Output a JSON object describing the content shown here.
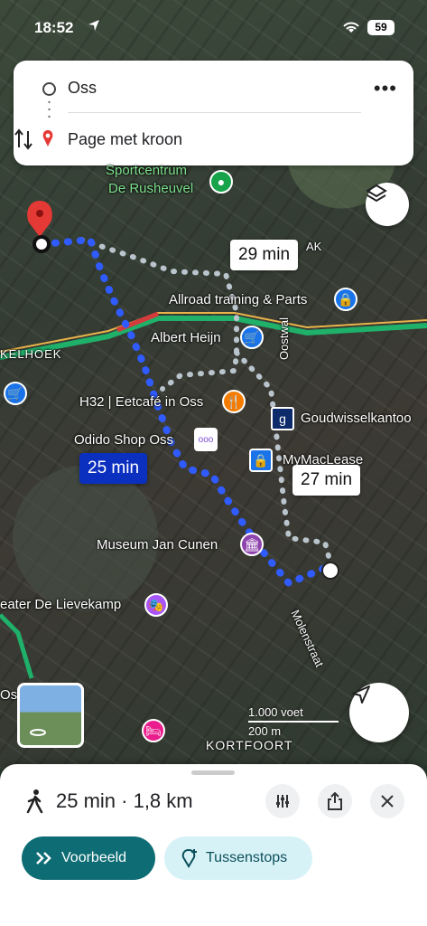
{
  "status_bar": {
    "time": "18:52",
    "battery": "59"
  },
  "route_card": {
    "origin": "Oss",
    "destination": "Page met kroon"
  },
  "map_labels": {
    "sportcentrum_1": "Sportcentrum",
    "sportcentrum_2": "De Rusheuvel",
    "allroad": "Allroad training & Parts",
    "albert_heijn": "Albert Heijn",
    "kelhoek": "KELHOEK",
    "h32": "H32 | Eetcafé in Oss",
    "goudwissel": "Goudwisselkantoo",
    "odido": "Odido Shop Oss",
    "mymaclease": "MyMacLease",
    "museum": "Museum Jan Cunen",
    "theater": "eater De Lievekamp",
    "oostwal": "Oostwal",
    "molenstraat": "Molenstraat",
    "kortfoort": "KORTFOORT",
    "oss_left": "Oss",
    "ak": "AK"
  },
  "callouts": {
    "alt1": "29 min",
    "selected": "25 min",
    "alt2": "27 min"
  },
  "scale": {
    "feet": "1.000 voet",
    "meters": "200 m"
  },
  "sheet": {
    "summary": "25 min · 1,8 km",
    "preview_label": "Voorbeeld",
    "stops_label": "Tussenstops"
  },
  "icons": {
    "walk": "walking-person-icon",
    "filter": "sliders-icon",
    "share": "share-icon",
    "close": "close-icon",
    "layers": "layers-icon",
    "locate": "navigation-arrow-icon",
    "more": "more-dots-icon",
    "swap": "swap-vertical-icon"
  },
  "colors": {
    "route_selected": "#2f5bff",
    "route_alt": "#b9c4cc",
    "accent_teal": "#0e6c74",
    "pin_red": "#e53935"
  }
}
